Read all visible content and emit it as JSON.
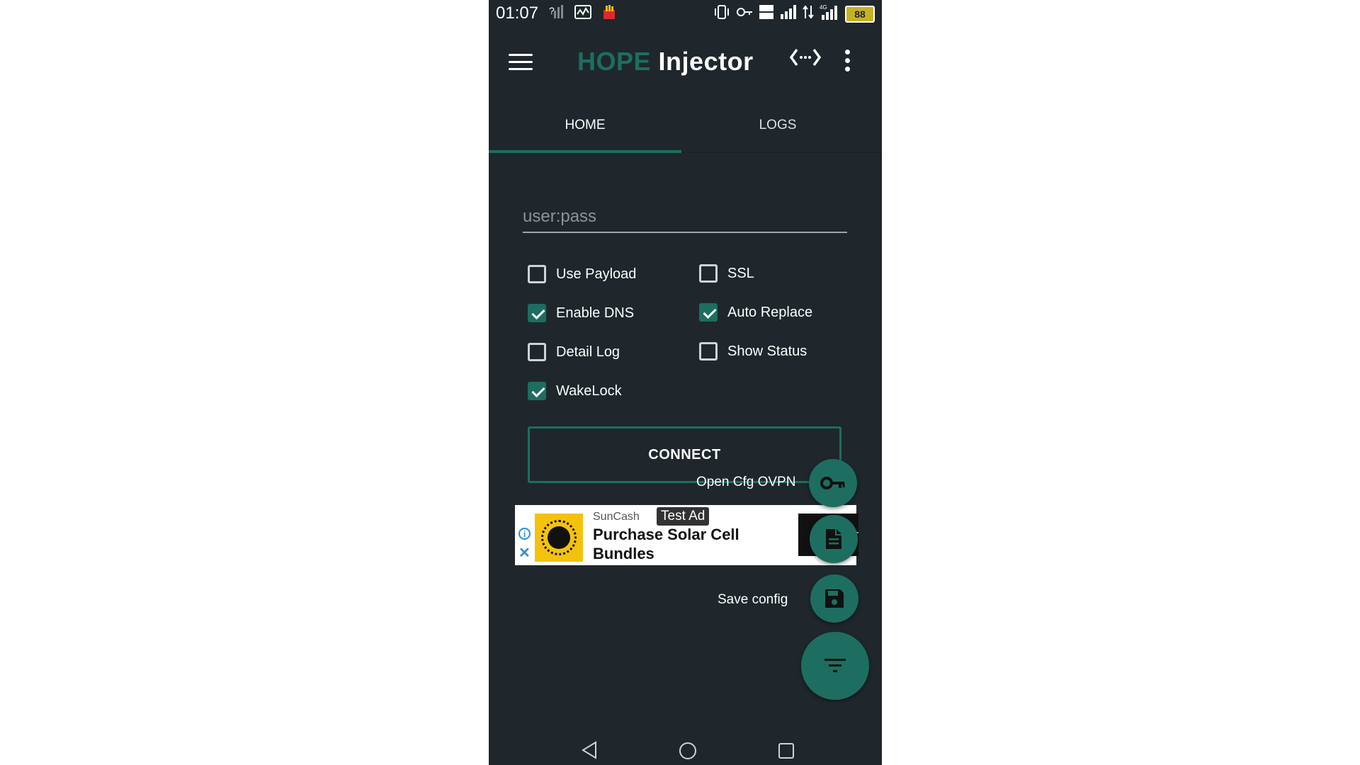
{
  "status_bar": {
    "time": "01:07",
    "battery": "88"
  },
  "app_bar": {
    "title_part1": "HOPE",
    "title_part2": "Injector"
  },
  "tabs": [
    {
      "label": "HOME",
      "selected": true
    },
    {
      "label": "LOGS",
      "selected": false
    }
  ],
  "login": {
    "placeholder": "user:pass",
    "value": ""
  },
  "options": [
    {
      "label": "Use Payload",
      "checked": false
    },
    {
      "label": "SSL",
      "checked": false
    },
    {
      "label": "Enable DNS",
      "checked": true
    },
    {
      "label": "Auto Replace",
      "checked": true
    },
    {
      "label": "Detail Log",
      "checked": false
    },
    {
      "label": "Show Status",
      "checked": false
    },
    {
      "label": "WakeLock",
      "checked": true
    }
  ],
  "connect_label": "CONNECT",
  "ad": {
    "sponsor": "SunCash",
    "badge": "Test Ad",
    "headline": "Purchase Solar Cell Bundles",
    "cta_fragment": "er"
  },
  "fab_menu": {
    "open_cfg_label": "Open Cfg OVPN",
    "save_config_label": "Save config"
  },
  "colors": {
    "accent": "#1d6e60",
    "background": "#1f272c",
    "ad_thumb": "#f4c20d"
  }
}
